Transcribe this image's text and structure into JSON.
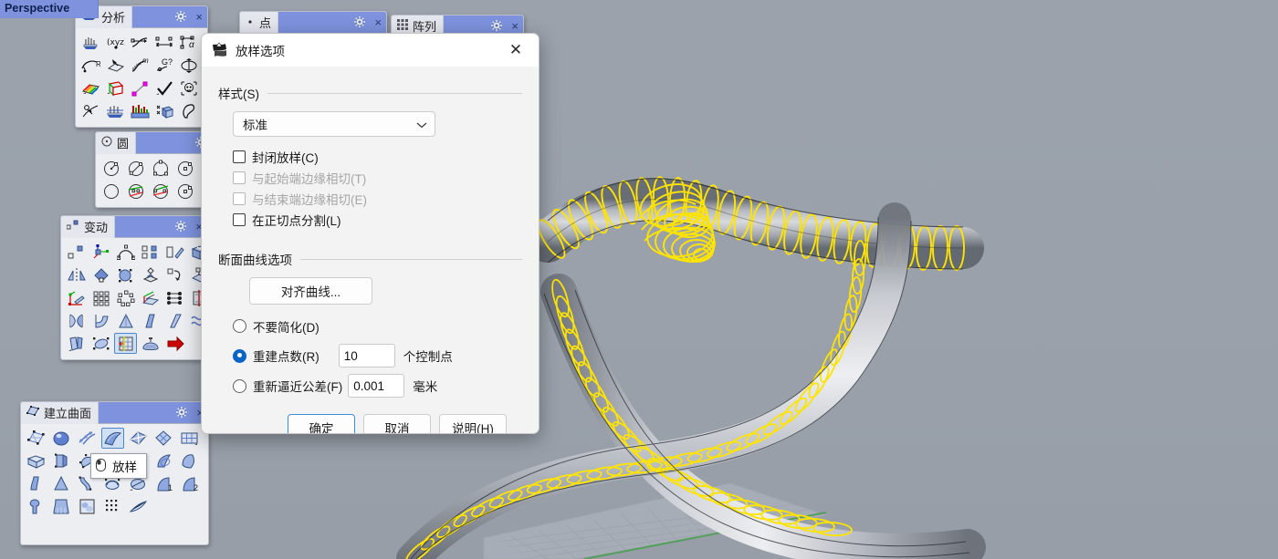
{
  "viewport": {
    "label": "Perspective",
    "background_color": "#9aa1ab",
    "curve_color": "#ffff00",
    "axis_color": "#13a013"
  },
  "panels": [
    {
      "title": "分析",
      "close": "×",
      "gear": "gear-icon"
    },
    {
      "title": "点",
      "close": "×",
      "gear": "gear-icon"
    },
    {
      "title": "阵列",
      "close": "×",
      "gear": "gear-icon"
    },
    {
      "title": "圆",
      "close": "×",
      "gear": "gear-icon"
    },
    {
      "title": "变动",
      "close": "×",
      "gear": "gear-icon"
    },
    {
      "title": "建立曲面",
      "close": "×",
      "gear": "gear-icon"
    }
  ],
  "tooltip": {
    "text": "放样"
  },
  "dialog": {
    "title": "放样选项",
    "close_glyph": "✕",
    "group_style": {
      "label": "样式(S)",
      "combo_value": "标准",
      "chevron": "chevron-down-icon",
      "checkboxes": [
        {
          "label": "封闭放样(C)",
          "checked": false,
          "disabled": false
        },
        {
          "label": "与起始端边缘相切(T)",
          "checked": false,
          "disabled": true
        },
        {
          "label": "与结束端边缘相切(E)",
          "checked": false,
          "disabled": true
        },
        {
          "label": "在正切点分割(L)",
          "checked": false,
          "disabled": false
        }
      ]
    },
    "group_section": {
      "label": "断面曲线选项",
      "align_button": "对齐曲线...",
      "radios": [
        {
          "label": "不要简化(D)",
          "selected": false
        },
        {
          "label": "重建点数(R)",
          "selected": true,
          "value": "10",
          "unit": "个控制点"
        },
        {
          "label": "重新逼近公差(F)",
          "selected": false,
          "value": "0.001",
          "unit": "毫米"
        }
      ]
    },
    "buttons": [
      {
        "label": "确定",
        "primary": true
      },
      {
        "label": "取消",
        "primary": false
      },
      {
        "label": "说明(H)",
        "primary": false
      }
    ]
  }
}
